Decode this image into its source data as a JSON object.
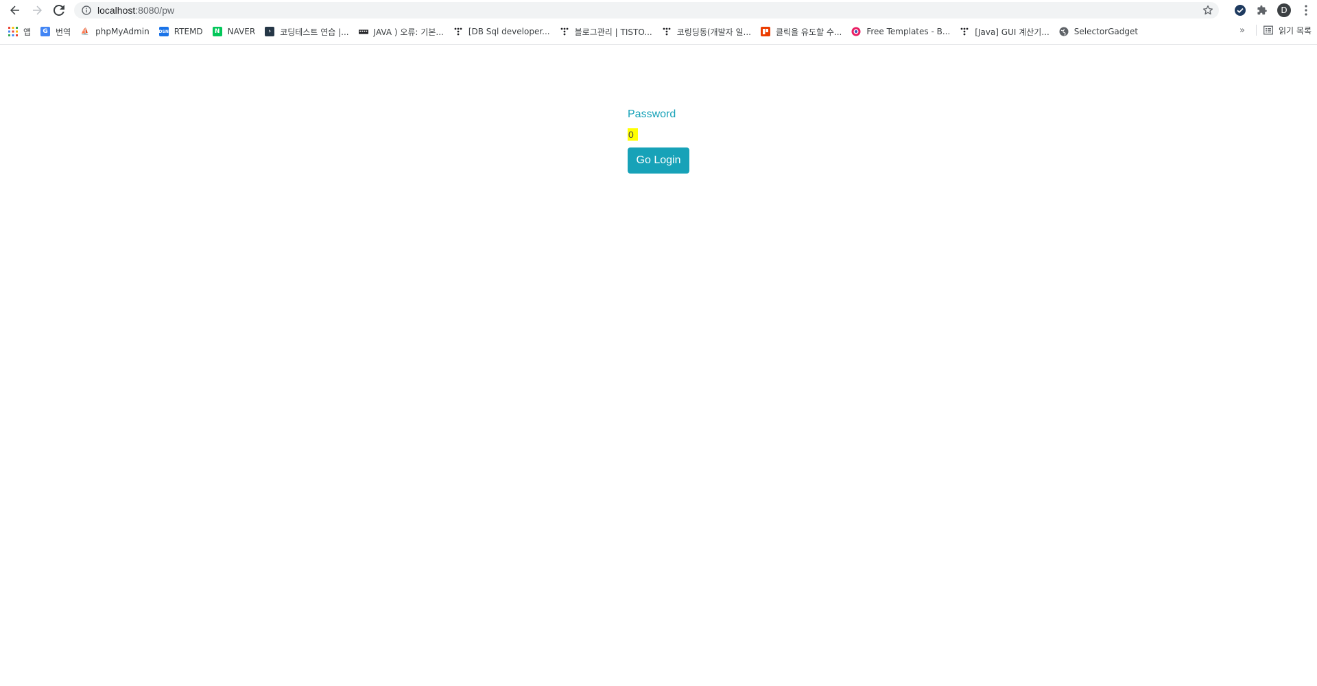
{
  "browser": {
    "url_host": "localhost",
    "url_path": ":8080/pw",
    "profile_initial": "D"
  },
  "bookmarks": [
    {
      "label": "앱",
      "icon": "apps-grid-icon",
      "color": "#ea4335"
    },
    {
      "label": "번역",
      "icon": "google-translate-icon",
      "color": "#4285f4"
    },
    {
      "label": "phpMyAdmin",
      "icon": "phpmyadmin-icon",
      "color": "#f89c0e"
    },
    {
      "label": "RTEMD",
      "icon": "rtemd-icon",
      "color": "#1a73e8"
    },
    {
      "label": "NAVER",
      "icon": "naver-icon",
      "color": "#03c75a"
    },
    {
      "label": "코딩테스트 연습 |...",
      "icon": "programmers-icon",
      "color": "#263747"
    },
    {
      "label": "JAVA ) 오류: 기본...",
      "icon": "keyboard-icon",
      "color": "#202124"
    },
    {
      "label": "[DB Sql developer...",
      "icon": "tistory-icon",
      "color": "#202124"
    },
    {
      "label": "블로그관리 | TISTO...",
      "icon": "tistory-icon",
      "color": "#202124"
    },
    {
      "label": "코링딩동(개발자 일...",
      "icon": "tistory-icon",
      "color": "#202124"
    },
    {
      "label": "클릭을 유도할 수...",
      "icon": "office-icon",
      "color": "#eb3c00"
    },
    {
      "label": "Free Templates - B...",
      "icon": "templates-icon",
      "color": "#e91e63"
    },
    {
      "label": "[Java] GUI 계산기...",
      "icon": "tistory-icon",
      "color": "#202124"
    },
    {
      "label": "SelectorGadget",
      "icon": "globe-icon",
      "color": "#5f6368"
    }
  ],
  "bookmarks_right": {
    "more": "»",
    "reading_list": "읽기 목록"
  },
  "page": {
    "password_label": "Password",
    "password_value": "0",
    "login_button": "Go Login"
  },
  "colors": {
    "accent": "#17a2b8",
    "highlight": "#ffff00"
  }
}
